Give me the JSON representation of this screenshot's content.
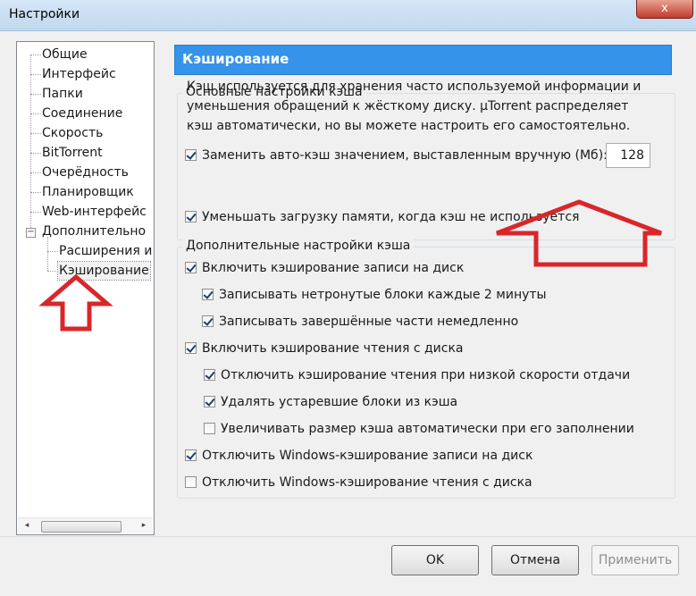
{
  "window": {
    "title": "Настройки",
    "close_glyph": "x"
  },
  "tree": {
    "items": [
      {
        "label": "Общие"
      },
      {
        "label": "Интерфейс"
      },
      {
        "label": "Папки"
      },
      {
        "label": "Соединение"
      },
      {
        "label": "Скорость"
      },
      {
        "label": "BitTorrent"
      },
      {
        "label": "Очерёдность"
      },
      {
        "label": "Планировщик"
      },
      {
        "label": "Web-интерфейс"
      },
      {
        "label": "Дополнительно",
        "expander": "−"
      },
      {
        "label": "Расширения ин"
      },
      {
        "label": "Кэширование",
        "selected": true
      }
    ],
    "scroll_left": "◂",
    "scroll_right": "▸"
  },
  "panel": {
    "header": "Кэширование",
    "basic": {
      "title": "Основные настройки кэша",
      "description": "Кэш используется для хранения часто используемой информации и уменьшения обращений к жёсткому диску. µTorrent распределяет кэш автоматически, но вы можете настроить его самостоятельно.",
      "override": {
        "label": "Заменить авто-кэш значением, выставленным вручную (Мб):",
        "checked": true,
        "value": "128"
      },
      "reduce": {
        "label": "Уменьшать загрузку памяти, когда кэш не используется",
        "checked": true
      }
    },
    "advanced": {
      "title": "Дополнительные настройки кэша",
      "items": [
        {
          "label": "Включить кэширование записи на диск",
          "checked": true
        },
        {
          "label": "Записывать нетронутые блоки каждые 2 минуты",
          "checked": true
        },
        {
          "label": "Записывать завершённые части немедленно",
          "checked": true
        },
        {
          "label": "Включить кэширование чтения с диска",
          "checked": true
        },
        {
          "label": "Отключить кэширование чтения при низкой скорости отдачи",
          "checked": true
        },
        {
          "label": "Удалять устаревшие блоки из кэша",
          "checked": true
        },
        {
          "label": "Увеличивать размер кэша автоматически при его заполнении",
          "checked": false
        },
        {
          "label": "Отключить Windows-кэширование записи на диск",
          "checked": true
        },
        {
          "label": "Отключить Windows-кэширование чтения с диска",
          "checked": false
        }
      ]
    }
  },
  "buttons": {
    "ok": "OK",
    "cancel": "Отмена",
    "apply": "Применить"
  },
  "colors": {
    "header_bg": "#3593ea",
    "annotation_arrow": "#d9262a"
  }
}
